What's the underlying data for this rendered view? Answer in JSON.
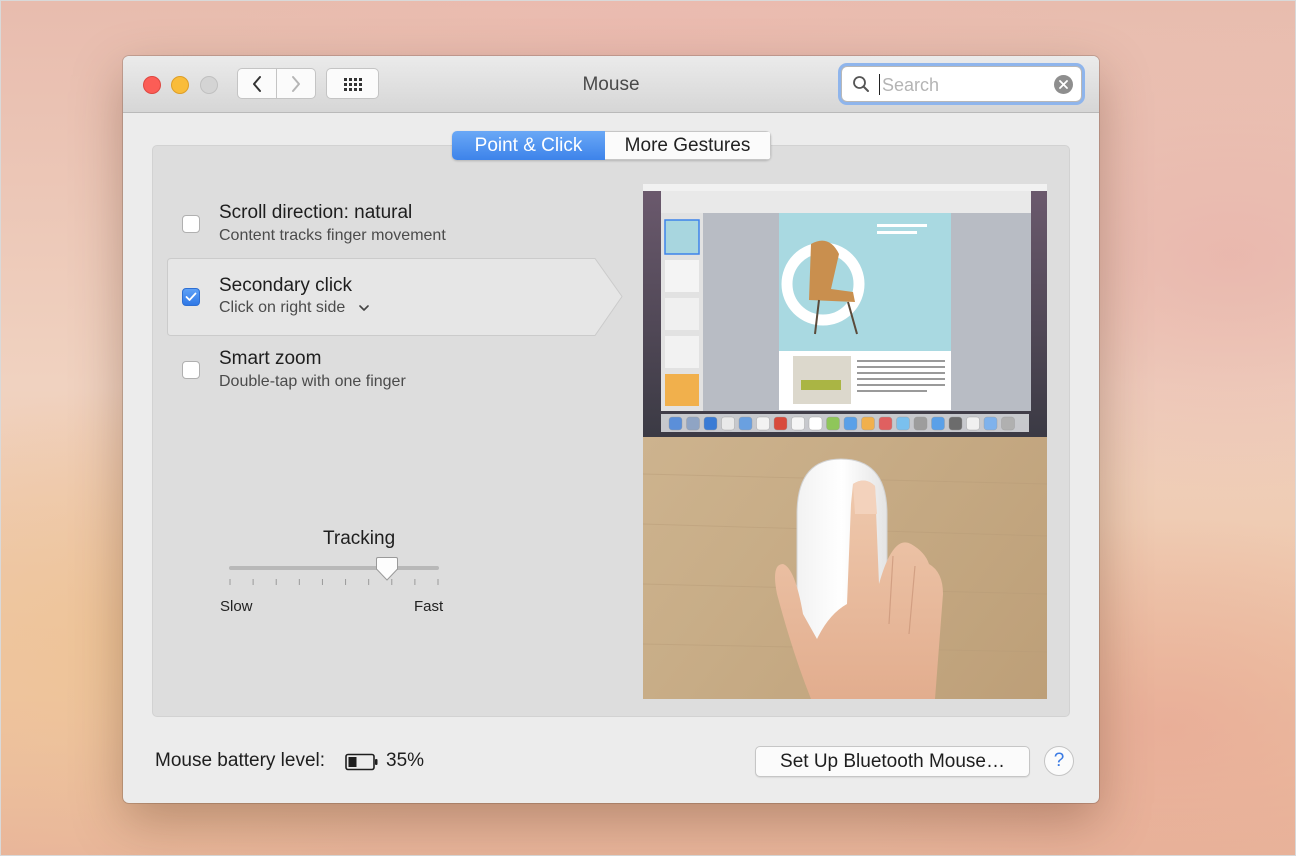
{
  "window": {
    "title": "Mouse",
    "traffic_lights": [
      "close",
      "minimize",
      "zoom"
    ]
  },
  "toolbar": {
    "back_icon": "chevron-left-icon",
    "forward_icon": "chevron-right-icon",
    "show_all_icon": "grid-icon"
  },
  "search": {
    "placeholder": "Search",
    "value": ""
  },
  "tabs": [
    {
      "label": "Point & Click",
      "active": true
    },
    {
      "label": "More Gestures",
      "active": false
    }
  ],
  "options": [
    {
      "title": "Scroll direction: natural",
      "subtitle": "Content tracks finger movement",
      "checked": false
    },
    {
      "title": "Secondary click",
      "subtitle": "Click on right side",
      "checked": true,
      "has_dropdown": true
    },
    {
      "title": "Smart zoom",
      "subtitle": "Double-tap with one finger",
      "checked": false
    }
  ],
  "tracking": {
    "label": "Tracking",
    "min_label": "Slow",
    "max_label": "Fast",
    "level": 0.75,
    "ticks": 10
  },
  "battery": {
    "label": "Mouse battery level:",
    "value": "35%",
    "level": 0.35
  },
  "buttons": {
    "bluetooth": "Set Up Bluetooth Mouse…",
    "help": "?"
  },
  "colors": {
    "accent": "#3d83ea",
    "close": "#fc5d56",
    "minimize": "#f9bc3a"
  }
}
